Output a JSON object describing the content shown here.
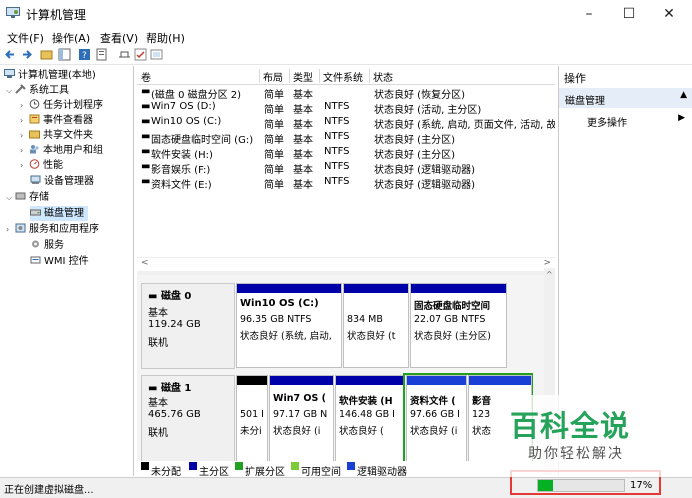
{
  "window": {
    "title": "计算机管理"
  },
  "menu": [
    "文件(F)",
    "操作(A)",
    "查看(V)",
    "帮助(H)"
  ],
  "tree": [
    {
      "label": "计算机管理(本地)",
      "icon": "computer-icon"
    },
    {
      "label": "系统工具",
      "icon": "tools-icon"
    },
    {
      "label": "任务计划程序",
      "icon": "clock-icon"
    },
    {
      "label": "事件查看器",
      "icon": "event-icon"
    },
    {
      "label": "共享文件夹",
      "icon": "folder-icon"
    },
    {
      "label": "本地用户和组",
      "icon": "users-icon"
    },
    {
      "label": "性能",
      "icon": "performance-icon"
    },
    {
      "label": "设备管理器",
      "icon": "device-icon"
    },
    {
      "label": "存储",
      "icon": "storage-icon"
    },
    {
      "label": "磁盘管理",
      "icon": "disk-icon"
    },
    {
      "label": "服务和应用程序",
      "icon": "services-icon"
    },
    {
      "label": "服务",
      "icon": "gear-icon"
    },
    {
      "label": "WMI 控件",
      "icon": "wmi-icon"
    }
  ],
  "volumes": {
    "headers": [
      "卷",
      "布局",
      "类型",
      "文件系统",
      "状态"
    ],
    "rows": [
      [
        "(磁盘 0 磁盘分区 2)",
        "简单",
        "基本",
        "",
        "状态良好 (恢复分区)"
      ],
      [
        "Win7 OS (D:)",
        "简单",
        "基本",
        "NTFS",
        "状态良好 (活动, 主分区)"
      ],
      [
        "Win10 OS (C:)",
        "简单",
        "基本",
        "NTFS",
        "状态良好 (系统, 启动, 页面文件, 活动, 故"
      ],
      [
        "固态硬盘临时空间 (G:)",
        "简单",
        "基本",
        "NTFS",
        "状态良好 (主分区)"
      ],
      [
        "软件安装 (H:)",
        "简单",
        "基本",
        "NTFS",
        "状态良好 (主分区)"
      ],
      [
        "影音娱乐 (F:)",
        "简单",
        "基本",
        "NTFS",
        "状态良好 (逻辑驱动器)"
      ],
      [
        "资料文件 (E:)",
        "简单",
        "基本",
        "NTFS",
        "状态良好 (逻辑驱动器)"
      ]
    ]
  },
  "disk0": {
    "name": "磁盘 0",
    "type": "基本",
    "size": "119.24 GB",
    "status": "联机",
    "parts": [
      {
        "name": "",
        "size": "",
        "status": ""
      },
      {
        "name": "Win10 OS  (C:)",
        "size": "96.35 GB NTFS",
        "status": "状态良好 (系统, 启动,"
      },
      {
        "name": "",
        "size": "834 MB",
        "status": "状态良好 (t"
      },
      {
        "name": "固态硬盘临时空间",
        "size": "22.07 GB NTFS",
        "status": "状态良好 (主分区)"
      }
    ]
  },
  "disk1": {
    "name": "磁盘 1",
    "type": "基本",
    "size": "465.76 GB",
    "status": "联机",
    "parts": [
      {
        "name": "",
        "size": "501 I",
        "status": "未分i"
      },
      {
        "name": "Win7 OS  (",
        "size": "97.17 GB N",
        "status": "状态良好 (i"
      },
      {
        "name": "软件安装  (H",
        "size": "146.48 GB I",
        "status": "状态良好 ("
      },
      {
        "name": "资料文件  (",
        "size": "97.66 GB I",
        "status": "状态良好 (i"
      },
      {
        "name": "影音",
        "size": "123",
        "status": "状态"
      }
    ]
  },
  "legend": [
    "未分配",
    "主分区",
    "扩展分区",
    "可用空间",
    "逻辑驱动器"
  ],
  "actions": {
    "header": "操作",
    "section": "磁盘管理",
    "item": "更多操作"
  },
  "status": {
    "text": "正在创建虚拟磁盘...",
    "progress_percent": 17,
    "progress_label": "17%"
  },
  "watermark": {
    "title": "百科全说",
    "subtitle": "助你轻松解决"
  },
  "colors": {
    "primary": "#0000a8",
    "logical": "#1a3fd6",
    "extended": "#22a022",
    "unallocated": "#000000",
    "free": "#7ccc3a",
    "progress": "#06b025",
    "highlight": "#e53935"
  }
}
